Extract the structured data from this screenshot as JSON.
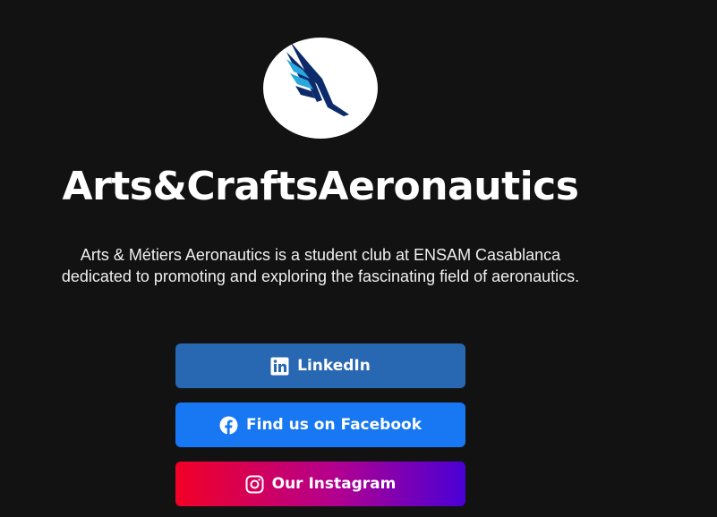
{
  "profile": {
    "logo": "aeronautics-wings-logo",
    "title": "Arts&CraftsAeronautics",
    "description": "Arts & Métiers Aeronautics is a student club at ENSAM Casablanca dedicated to promoting and exploring the fascinating field of aeronautics."
  },
  "links": [
    {
      "label": "LinkedIn",
      "icon": "linkedin-icon",
      "color": "#2867b2"
    },
    {
      "label": "Find us on Facebook",
      "icon": "facebook-icon",
      "color": "#1877f2"
    },
    {
      "label": "Our Instagram",
      "icon": "instagram-icon",
      "gradient": [
        "#f20026",
        "#b3008f",
        "#4a00d6"
      ]
    }
  ],
  "colors": {
    "background": "#121212",
    "logo_dark_blue": "#0d2b6b",
    "logo_light_blue": "#29a8e0"
  }
}
